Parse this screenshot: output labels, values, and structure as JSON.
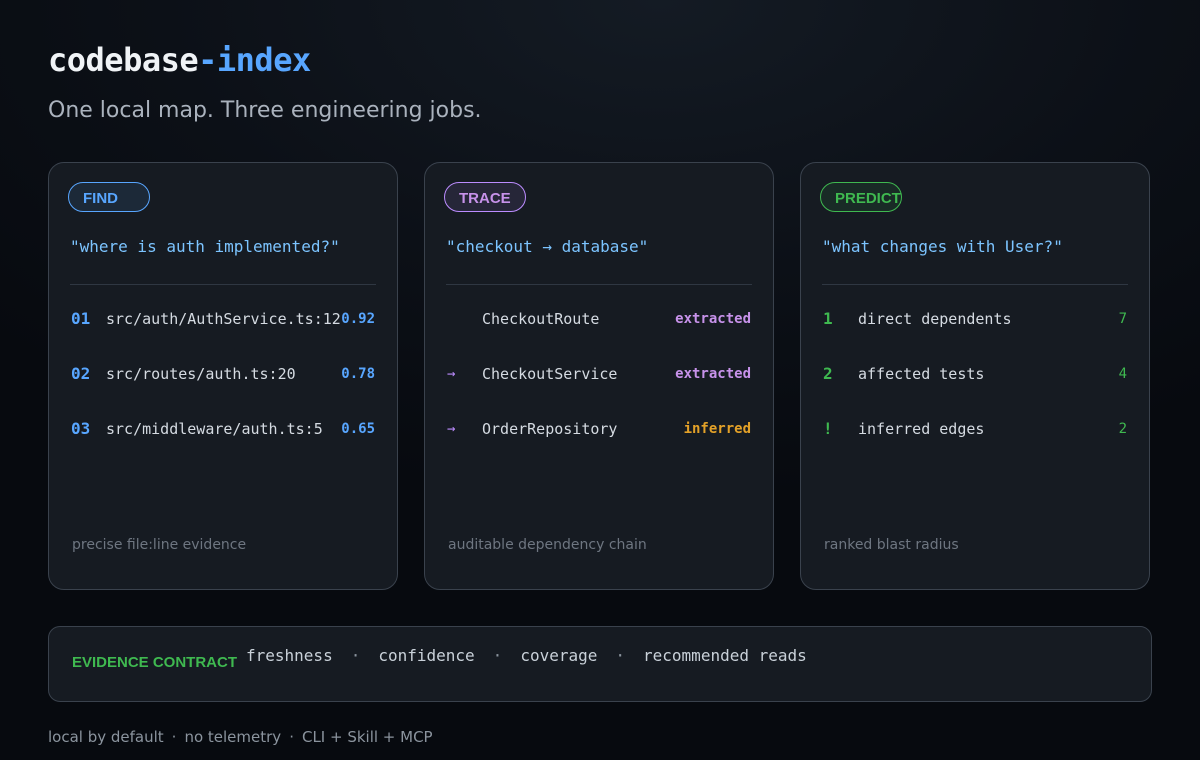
{
  "header": {
    "title_part1": "codebase",
    "title_part2": "-index",
    "subtitle": "One local map. Three engineering jobs."
  },
  "cards": [
    {
      "tag": "FIND",
      "query": "\"where is auth implemented?\"",
      "rows": [
        {
          "lead": "01",
          "text": "src/auth/AuthService.ts:12",
          "value": "0.92"
        },
        {
          "lead": "02",
          "text": "src/routes/auth.ts:20",
          "value": "0.78"
        },
        {
          "lead": "03",
          "text": "src/middleware/auth.ts:5",
          "value": "0.65"
        }
      ],
      "footnote": "precise file:line evidence"
    },
    {
      "tag": "TRACE",
      "query": "\"checkout → database\"",
      "rows": [
        {
          "lead": "",
          "text": "CheckoutRoute",
          "value": "extracted"
        },
        {
          "lead": "→",
          "text": "CheckoutService",
          "value": "extracted"
        },
        {
          "lead": "→",
          "text": "OrderRepository",
          "value": "inferred"
        }
      ],
      "footnote": "auditable dependency chain"
    },
    {
      "tag": "PREDICT",
      "query": "\"what changes with User?\"",
      "rows": [
        {
          "lead": "1",
          "text": "direct dependents",
          "value": "7"
        },
        {
          "lead": "2",
          "text": "affected tests",
          "value": "4"
        },
        {
          "lead": "!",
          "text": "inferred edges",
          "value": "2"
        }
      ],
      "footnote": "ranked blast radius"
    }
  ],
  "contract": {
    "label": "EVIDENCE CONTRACT",
    "items": [
      "freshness",
      "confidence",
      "coverage",
      "recommended reads"
    ],
    "separator": "·"
  },
  "footer": {
    "items": [
      "local by default",
      "no telemetry",
      "CLI + Skill + MCP"
    ],
    "separator": "·"
  },
  "colors": {
    "find": "#58a6ff",
    "trace": "#bc8cff",
    "predict": "#3fb950",
    "inferred": "#e3a128"
  }
}
